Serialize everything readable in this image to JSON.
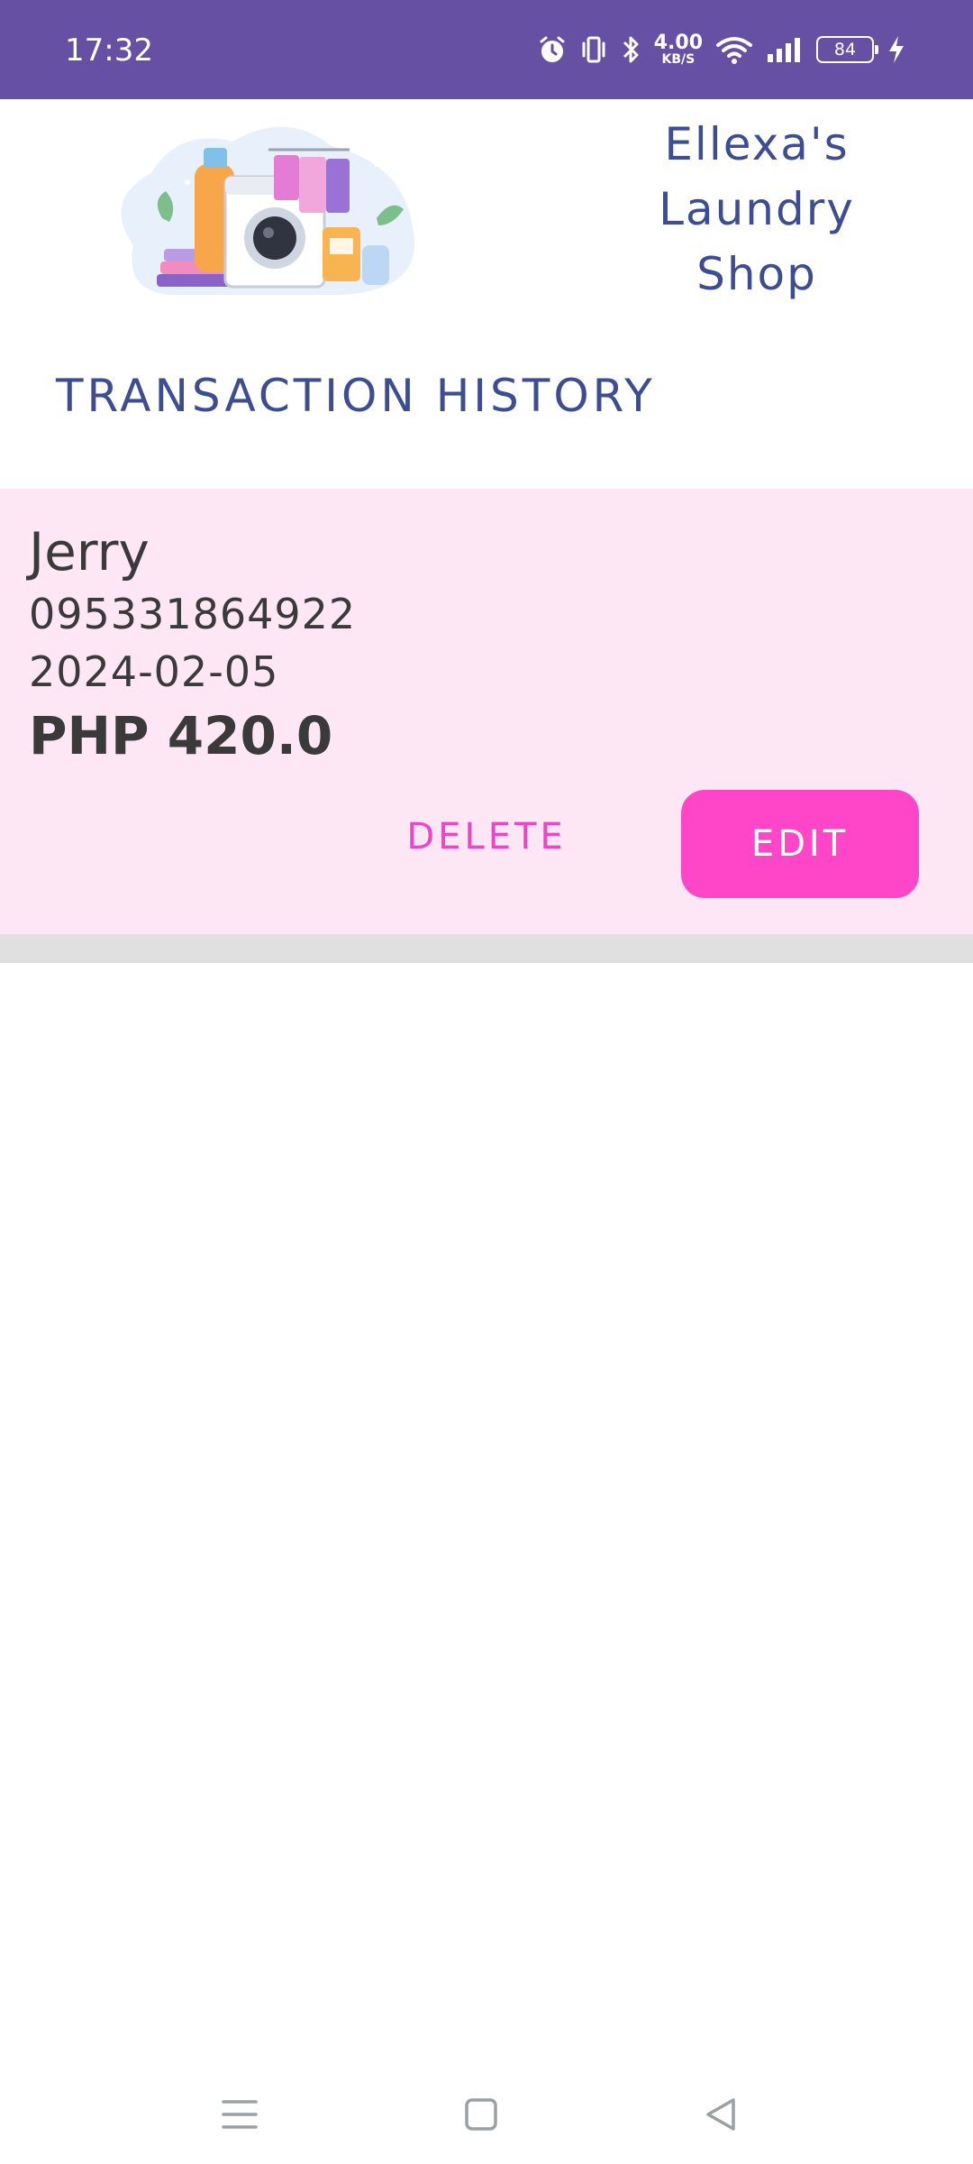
{
  "status_bar": {
    "time": "17:32",
    "network_speed_value": "4.00",
    "network_speed_unit": "KB/S",
    "battery": "84",
    "icons": [
      "alarm-icon",
      "vibrate-icon",
      "bluetooth-icon",
      "wifi-icon",
      "signal-icon",
      "battery-icon",
      "charging-icon"
    ]
  },
  "header": {
    "logo_icon": "laundry-illustration",
    "shop_name_lines": [
      "Ellexa's",
      "Laundry",
      "Shop"
    ]
  },
  "section": {
    "title": "TRANSACTION HISTORY"
  },
  "transactions": [
    {
      "name": "Jerry",
      "phone": "095331864922",
      "date": "2024-02-05",
      "amount": "PHP 420.0",
      "delete_label": "DELETE",
      "edit_label": "EDIT"
    }
  ],
  "nav_bar": {
    "icons": [
      "menu-icon",
      "home-icon",
      "back-icon"
    ]
  },
  "colors": {
    "status_bar": "#6650a4",
    "title_blue": "#3c4e91",
    "card_bg": "#fde7f4",
    "accent_pink": "#ff46c8",
    "divider": "#e0e0e0"
  }
}
